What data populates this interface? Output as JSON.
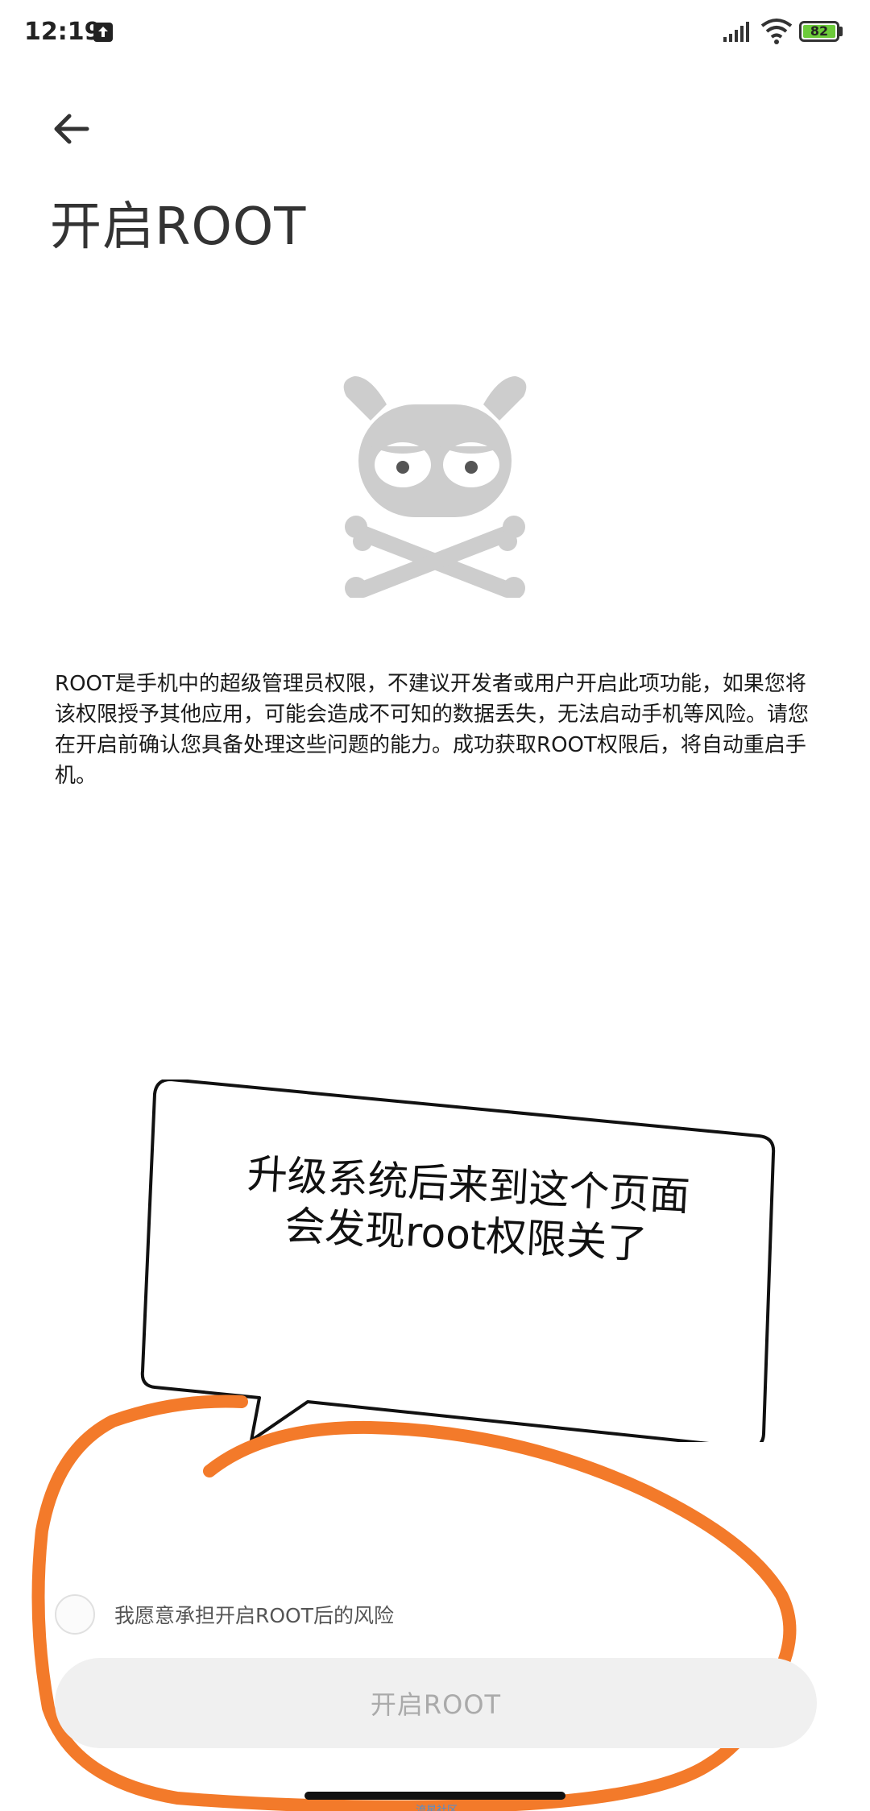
{
  "status_bar": {
    "time": "12:19",
    "battery_level": "82",
    "icons": [
      "upload-icon",
      "signal-icon",
      "wifi-icon",
      "battery-icon"
    ]
  },
  "header": {
    "back_icon": "arrow-left-icon",
    "title": "开启ROOT"
  },
  "mascot_icon": "skull-crossbones-mascot",
  "description": "ROOT是手机中的超级管理员权限，不建议开发者或用户开启此项功能，如果您将该权限授予其他应用，可能会造成不可知的数据丢失，无法启动手机等风险。请您在开启前确认您具备处理这些问题的能力。成功获取ROOT权限后，将自动重启手机。",
  "annotation": {
    "text": "升级系统后来到这个页面会发现root权限关了",
    "scribble_color": "#f37a2a"
  },
  "consent": {
    "label": "我愿意承担开启ROOT后的风险",
    "checked": false
  },
  "enable_button": {
    "label": "开启ROOT"
  },
  "watermark": "流星社区"
}
